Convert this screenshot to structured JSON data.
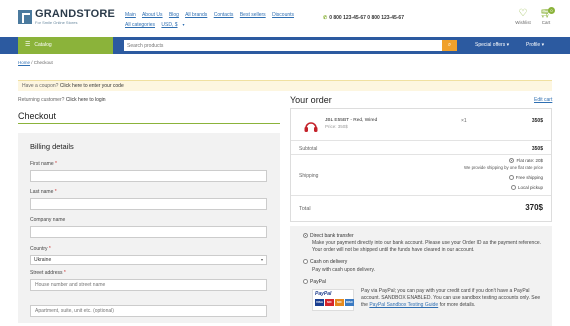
{
  "header": {
    "logo_name": "GRANDSTORE",
    "logo_tagline": "For Smile Online Stores",
    "nav_row1": [
      "Main",
      "About Us",
      "Blog",
      "All brands",
      "Contacts",
      "Best sellers",
      "Discounts"
    ],
    "nav_row2": [
      "All categories",
      "USD, $"
    ],
    "phone": "0 800 123-45-67 0 800 123-45-67",
    "wishlist_label": "Wishlist",
    "cart_label": "Cart",
    "cart_count": "0"
  },
  "navbar": {
    "catalog_label": "Catalog",
    "search_placeholder": "Search products",
    "special_offers": "Special offers",
    "profile": "Profile"
  },
  "breadcrumb": {
    "home": "Home",
    "separator": " / ",
    "current": "Checkout"
  },
  "coupon": {
    "prefix": "Have a coupon?",
    "link": "Click here to enter your code"
  },
  "returning": {
    "prefix": "Returning customer?",
    "link": "Click here to login"
  },
  "checkout_title": "Checkout",
  "billing": {
    "title": "Billing details",
    "first_name_label": "First name",
    "last_name_label": "Last name",
    "company_label": "Company name",
    "country_label": "Country",
    "country_value": "Ukraine",
    "street_label": "Street address",
    "street_placeholder": "House number and street name",
    "street2_placeholder": "Apartment, suite, unit etc. (optional)",
    "required_mark": "*"
  },
  "order": {
    "title": "Your order",
    "edit_cart": "Edit cart",
    "product_name": "JBL E55BT - Red, Wired",
    "product_price": "Price: 350$",
    "product_qty": "×1",
    "product_total": "350$",
    "subtotal_label": "Subtotal",
    "subtotal_value": "350$",
    "shipping_label": "Shipping",
    "flat_rate": "Flat rate: 20$",
    "flat_note": "We provide shipping by one flat rate price",
    "free_shipping": "Free shipping",
    "local_pickup": "Local pickup",
    "total_label": "Total",
    "total_value": "370$"
  },
  "payment": {
    "bank_label": "Direct bank transfer",
    "bank_desc": "Make your payment directly into our bank account. Please use your Order ID as the payment reference. Your order will not be shipped until the funds have cleared in our account.",
    "cod_label": "Cash on delivery",
    "cod_desc": "Pay with cash upon delivery.",
    "paypal_label": "PayPal",
    "paypal_logo_text": "PayPal",
    "paypal_desc": "Pay via PayPal; you can pay with your credit card if you don't have a PayPal account. SANDBOX ENABLED. You can use sandbox testing accounts only. See the",
    "paypal_link": "PayPal Sandbox Testing Guide",
    "paypal_desc_end": "for more details.",
    "card_labels": [
      "VISA",
      "MC",
      "MC",
      "DISC"
    ]
  },
  "colors": {
    "brand_green": "#8bb33a",
    "nav_blue": "#2c5aa0",
    "search_orange": "#f0a12c"
  }
}
